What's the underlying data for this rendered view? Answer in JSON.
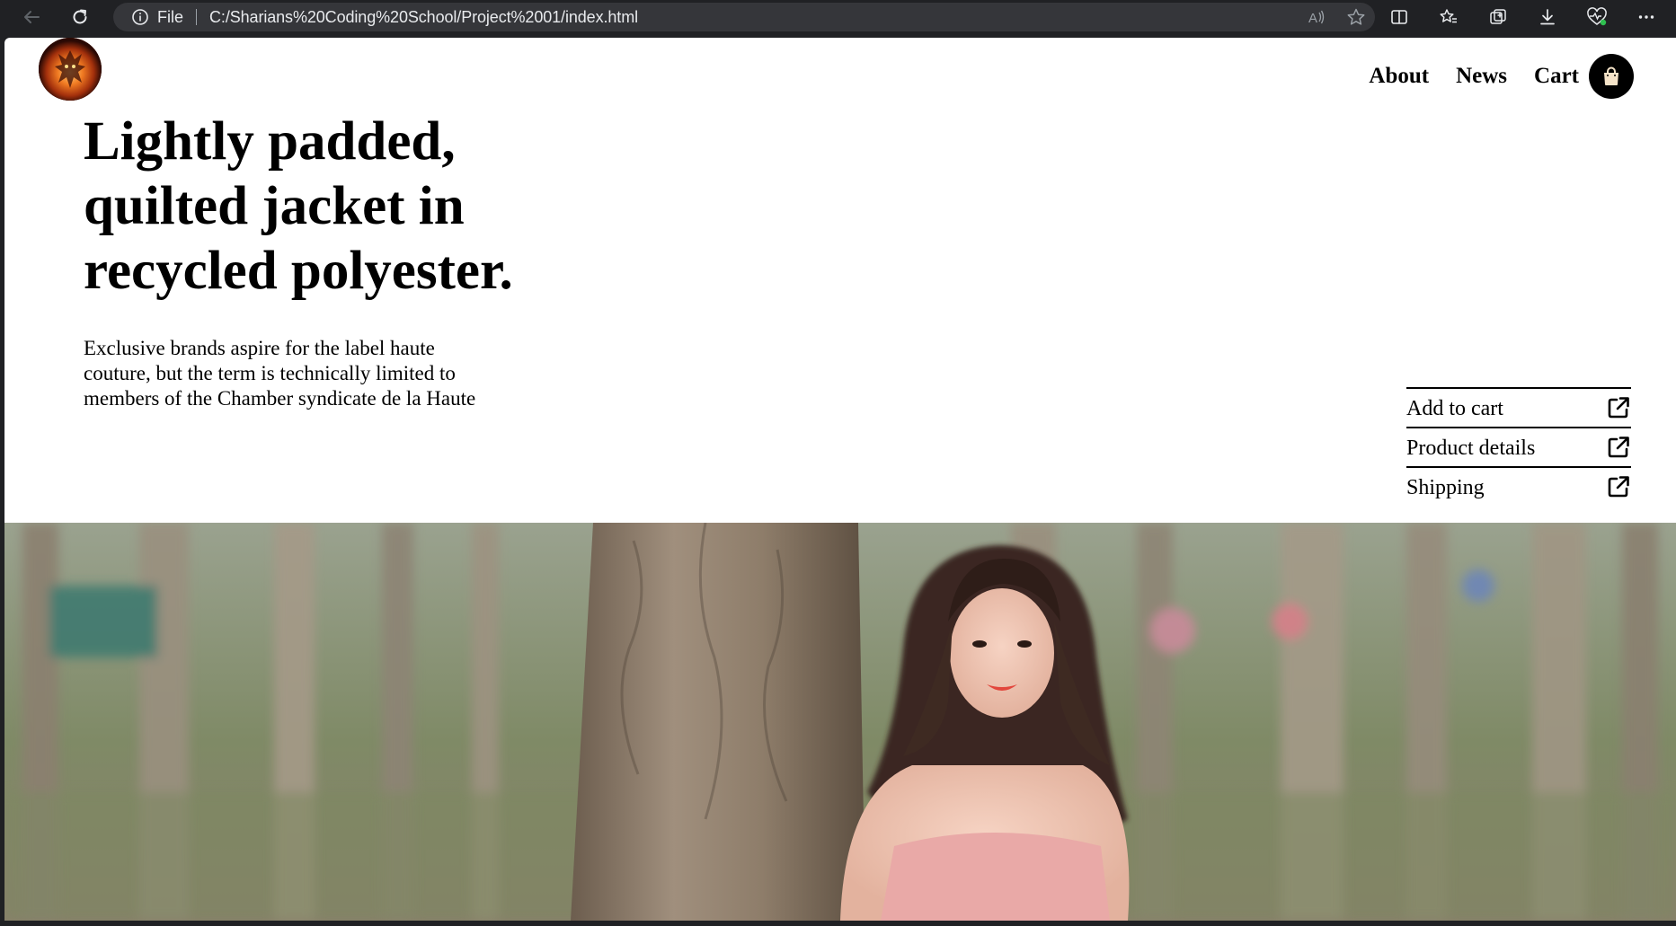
{
  "browser": {
    "scheme_label": "File",
    "url": "C:/Sharians%20Coding%20School/Project%2001/index.html"
  },
  "header": {
    "nav": [
      {
        "label": "About"
      },
      {
        "label": "News"
      },
      {
        "label": "Cart"
      }
    ]
  },
  "hero_text": {
    "headline_lines": [
      "Lightly padded,",
      "quilted jacket in",
      "recycled polyester."
    ],
    "description_lines": [
      "Exclusive brands aspire for the label haute",
      "couture, but the term is technically limited to",
      "members of the Chamber syndicate de la Haute"
    ]
  },
  "actions": [
    {
      "label": "Add to cart",
      "icon": "external-link-icon"
    },
    {
      "label": "Product details",
      "icon": "external-link-icon"
    },
    {
      "label": "Shipping",
      "icon": "external-link-icon"
    }
  ],
  "colors": {
    "page_bg": "#ffffff",
    "text": "#000000",
    "chrome_bg": "#202124"
  }
}
